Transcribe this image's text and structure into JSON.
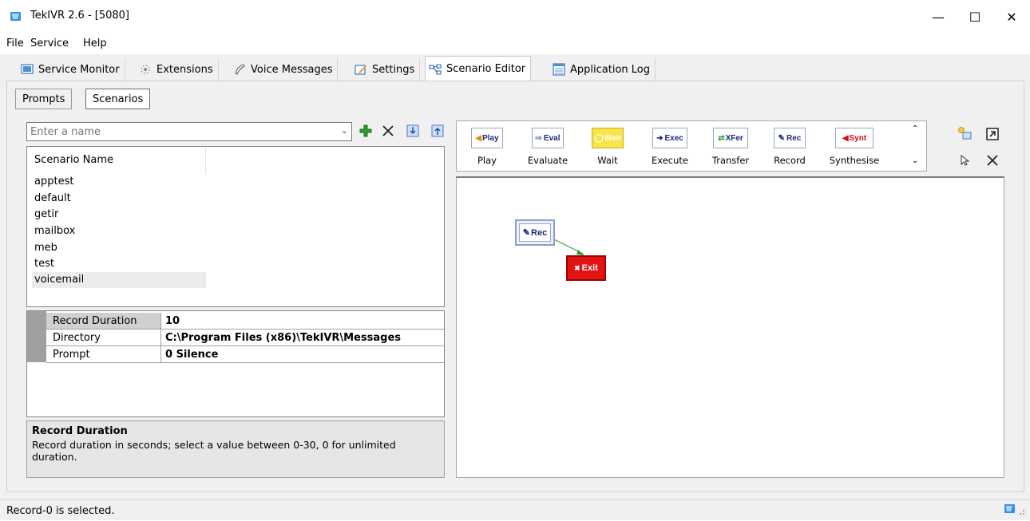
{
  "window": {
    "title": "TekIVR 2.6 - [5080]",
    "min_glyph": "—",
    "max_glyph": "☐",
    "close_glyph": "✕"
  },
  "menu": {
    "file": "File",
    "service": "Service",
    "help": "Help"
  },
  "tabs": [
    {
      "label": "Service Monitor",
      "icon": "monitor-icon"
    },
    {
      "label": "Extensions",
      "icon": "extensions-icon"
    },
    {
      "label": "Voice Messages",
      "icon": "voice-messages-icon"
    },
    {
      "label": "Settings",
      "icon": "settings-icon"
    },
    {
      "label": "Scenario Editor",
      "icon": "scenario-editor-icon"
    },
    {
      "label": "Application Log",
      "icon": "application-log-icon"
    }
  ],
  "subtabs": {
    "prompts": "Prompts",
    "scenarios": "Scenarios"
  },
  "scenario_toolbar": {
    "name_placeholder": "Enter a name"
  },
  "scenario_list": {
    "header": "Scenario Name",
    "items": [
      "apptest",
      "default",
      "getir",
      "mailbox",
      "meb",
      "test",
      "voicemail"
    ]
  },
  "properties": [
    {
      "name": "Record Duration",
      "value": "10"
    },
    {
      "name": "Directory",
      "value": "C:\\Program Files (x86)\\TekIVR\\Messages"
    },
    {
      "name": "Prompt",
      "value": "0 Silence"
    }
  ],
  "help": {
    "title": "Record Duration",
    "text": "Record duration in seconds; select a value between 0-30, 0 for unlimited duration."
  },
  "palette": [
    {
      "button": "Play",
      "label": "Play",
      "color": "#1a2a7a",
      "icon": "play-icon"
    },
    {
      "button": "Eval",
      "label": "Evaluate",
      "color": "#1a2a7a",
      "icon": "evaluate-icon"
    },
    {
      "button": "Wait",
      "label": "Wait",
      "color": "#ffffff",
      "icon": "wait-icon"
    },
    {
      "button": "Exec",
      "label": "Execute",
      "color": "#1a2a7a",
      "icon": "execute-icon"
    },
    {
      "button": "XFer",
      "label": "Transfer",
      "color": "#1a2a7a",
      "icon": "transfer-icon"
    },
    {
      "button": "Rec",
      "label": "Record",
      "color": "#1a2a7a",
      "icon": "record-icon"
    },
    {
      "button": "Synt",
      "label": "Synthesise",
      "color": "#d01010",
      "icon": "synthesise-icon"
    }
  ],
  "canvas": {
    "rec_node": "Rec",
    "exit_node": "Exit"
  },
  "status": {
    "text": "Record-0 is selected."
  },
  "colors": {
    "exit_node": "#e21313",
    "wait_button": "#f7e34a",
    "add_icon": "#2e9e2e"
  }
}
